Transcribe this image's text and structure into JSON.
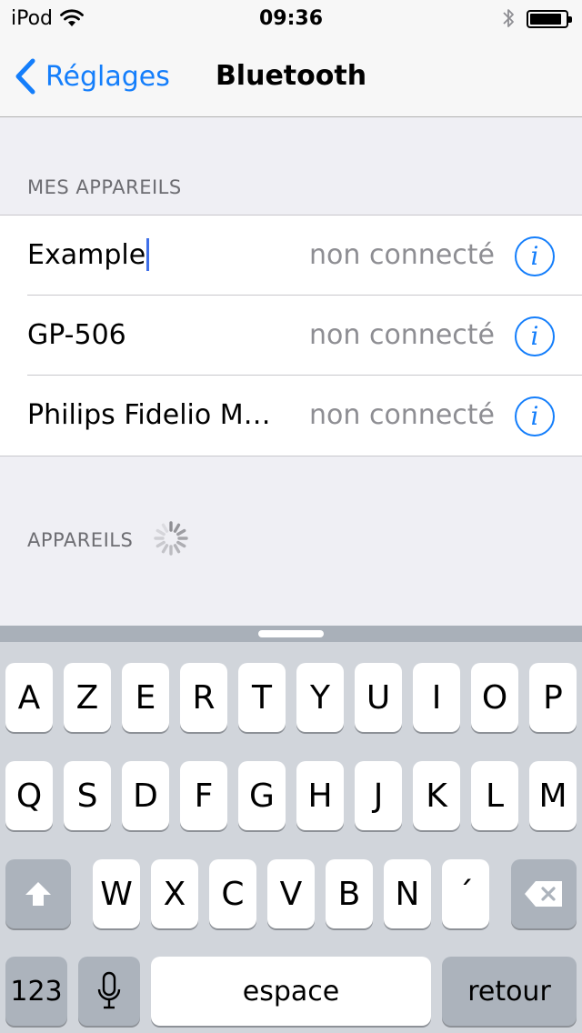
{
  "status_bar": {
    "carrier": "iPod",
    "time": "09:36"
  },
  "nav": {
    "back_label": "Réglages",
    "title": "Bluetooth"
  },
  "my_devices": {
    "header": "MES APPAREILS",
    "items": [
      {
        "name": "Example",
        "status": "non connecté"
      },
      {
        "name": "GP-506",
        "status": "non connecté"
      },
      {
        "name": "Philips Fidelio M2...",
        "status": "non connecté"
      }
    ]
  },
  "devices": {
    "header": "APPAREILS"
  },
  "keyboard": {
    "row1": [
      "A",
      "Z",
      "E",
      "R",
      "T",
      "Y",
      "U",
      "I",
      "O",
      "P"
    ],
    "row2": [
      "Q",
      "S",
      "D",
      "F",
      "G",
      "H",
      "J",
      "K",
      "L",
      "M"
    ],
    "row3": [
      "W",
      "X",
      "C",
      "V",
      "B",
      "N",
      "´"
    ],
    "numbers_label": "123",
    "space_label": "espace",
    "return_label": "retour"
  },
  "colors": {
    "accent": "#147efb",
    "caret": "#3f6fe8",
    "keyboard_bg": "#d1d5db"
  },
  "icons": {
    "wifi": "wifi-icon",
    "bluetooth": "bluetooth-icon",
    "battery": "battery-icon",
    "back": "chevron-left-icon",
    "info": "info-icon",
    "spinner": "activity-spinner-icon",
    "shift": "shift-icon",
    "delete": "delete-icon",
    "mic": "microphone-icon"
  }
}
